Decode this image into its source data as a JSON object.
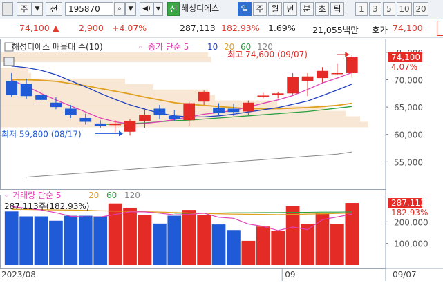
{
  "toolbar": {
    "checkbox_label": "",
    "market_label": "주",
    "mode_label": "전",
    "stock_code": "195870",
    "stock_name": "해성디에스",
    "new_badge": "신",
    "periods": [
      "일",
      "주",
      "월",
      "년",
      "분",
      "초",
      "틱"
    ],
    "active_period": "일",
    "intervals": [
      "1",
      "3",
      "5",
      "10",
      "20"
    ]
  },
  "quote": {
    "price": "74,100",
    "change_arrow": "▲",
    "change": "2,900",
    "change_pct": "+4.07%",
    "volume": "287,113",
    "volume_ratio": "182.93%",
    "turnover": "1.69%",
    "amount": "21,055백만",
    "ask_label": "호가",
    "ask_price": "74,100"
  },
  "price_panel": {
    "legend_name": "해성디에스 매물대 수(10)",
    "ma_label": "종가 단순 5",
    "ma_periods": [
      "10",
      "20",
      "60",
      "120"
    ],
    "high_label": "최고 74,600 (09/07)",
    "low_label": "최저 59,800 (08/17)",
    "current_price_tag": "74,100",
    "change_pct_tag": "4.07%",
    "y_ticks": [
      "75,000",
      "70,000",
      "65,000",
      "60,000",
      "55,000"
    ]
  },
  "volume_panel": {
    "legend_label": "거래량 단순 5",
    "ma_periods": [
      "20",
      "60",
      "120"
    ],
    "value_label": "287,113주(182.93%)",
    "volume_tag": "287,113",
    "ratio_tag": "182.93%",
    "y_ticks": [
      "200,000",
      "100,000"
    ]
  },
  "x_axis": {
    "labels": [
      "2023/08",
      "09"
    ],
    "cursor_date": "09/07"
  },
  "colors": {
    "up": "#e52b25",
    "down": "#1f5bd6",
    "ma5": "#e040b5",
    "ma10": "#2040c0",
    "ma20": "#e0a020",
    "ma60": "#2aa040",
    "ma120": "#888888"
  },
  "chart_data": {
    "type": "candlestick",
    "price": {
      "ylim": [
        50000,
        77000
      ],
      "candles": [
        {
          "o": 69800,
          "h": 71200,
          "l": 66800,
          "c": 67200
        },
        {
          "o": 69300,
          "h": 70200,
          "l": 66500,
          "c": 67000
        },
        {
          "o": 67200,
          "h": 68000,
          "l": 66000,
          "c": 66300
        },
        {
          "o": 65800,
          "h": 66800,
          "l": 64600,
          "c": 65000
        },
        {
          "o": 64700,
          "h": 65400,
          "l": 63000,
          "c": 63500
        },
        {
          "o": 63000,
          "h": 63800,
          "l": 61800,
          "c": 62300
        },
        {
          "o": 62000,
          "h": 62600,
          "l": 61200,
          "c": 61600
        },
        {
          "o": 61700,
          "h": 62600,
          "l": 60400,
          "c": 62000
        },
        {
          "o": 60500,
          "h": 62800,
          "l": 59800,
          "c": 62400
        },
        {
          "o": 62400,
          "h": 64800,
          "l": 61200,
          "c": 63600
        },
        {
          "o": 64700,
          "h": 65400,
          "l": 62800,
          "c": 63600
        },
        {
          "o": 63400,
          "h": 64400,
          "l": 62400,
          "c": 62800
        },
        {
          "o": 62600,
          "h": 66000,
          "l": 61600,
          "c": 65700
        },
        {
          "o": 66000,
          "h": 68000,
          "l": 65400,
          "c": 67800
        },
        {
          "o": 64900,
          "h": 65700,
          "l": 63600,
          "c": 63900
        },
        {
          "o": 64700,
          "h": 65600,
          "l": 63400,
          "c": 64100
        },
        {
          "o": 64200,
          "h": 66200,
          "l": 63600,
          "c": 65800
        },
        {
          "o": 67000,
          "h": 67600,
          "l": 66600,
          "c": 67100
        },
        {
          "o": 67200,
          "h": 67800,
          "l": 66600,
          "c": 67500
        },
        {
          "o": 67500,
          "h": 71200,
          "l": 67300,
          "c": 70500
        },
        {
          "o": 69800,
          "h": 71200,
          "l": 67000,
          "c": 70600
        },
        {
          "o": 70300,
          "h": 72300,
          "l": 69500,
          "c": 71600
        },
        {
          "o": 71200,
          "h": 73000,
          "l": 70800,
          "c": 71200
        },
        {
          "o": 71200,
          "h": 74600,
          "l": 70400,
          "c": 74100
        }
      ],
      "ma5": [
        69900,
        68800,
        67500,
        66300,
        65200,
        64100,
        63000,
        62300,
        61900,
        62000,
        62300,
        62700,
        63200,
        63700,
        64000,
        64400,
        65000,
        65700,
        66300,
        67100,
        68200,
        69400,
        70300,
        71300
      ],
      "ma10": [
        72500,
        72200,
        71700,
        70900,
        69800,
        68700,
        67500,
        66400,
        65400,
        64600,
        63900,
        63400,
        63200,
        63200,
        63400,
        63700,
        64100,
        64500,
        64900,
        65500,
        66100,
        67100,
        68100,
        69200
      ],
      "ma20": [
        70000,
        70000,
        69900,
        69700,
        69300,
        68900,
        68400,
        67900,
        67400,
        66800,
        66300,
        65800,
        65500,
        65300,
        65100,
        64900,
        64700,
        64700,
        64700,
        64800,
        64900,
        65100,
        65300,
        65700
      ],
      "ma60": [
        null,
        null,
        null,
        null,
        null,
        null,
        61800,
        61900,
        62000,
        62100,
        62300,
        62500,
        62600,
        62800,
        63000,
        63200,
        63400,
        63600,
        63800,
        64000,
        64200,
        64500,
        64800,
        65100
      ],
      "ma120": [
        null,
        52200,
        52400,
        52600,
        52800,
        53000,
        53200,
        53400,
        53600,
        53800,
        54000,
        54200,
        54400,
        54600,
        54800,
        55000,
        55200,
        55400,
        55600,
        55800,
        56000,
        56200,
        56400,
        56800
      ]
    },
    "volume": {
      "ylim": [
        0,
        300000
      ],
      "values": [
        248000,
        225000,
        225000,
        205000,
        228000,
        228000,
        225000,
        285000,
        265000,
        232000,
        192000,
        228000,
        255000,
        232000,
        188000,
        162000,
        112000,
        178000,
        158000,
        272000,
        190000,
        240000,
        190000,
        287113
      ],
      "ma5": [
        270000,
        262000,
        255000,
        242000,
        226000,
        222000,
        222000,
        234000,
        246000,
        246000,
        240000,
        232000,
        234000,
        240000,
        221000,
        216000,
        190000,
        179000,
        160000,
        176000,
        164000,
        210000,
        222000,
        236000
      ],
      "ma20": [
        258000,
        257000,
        256000,
        255000,
        254000,
        253000,
        251000,
        250000,
        249000,
        247000,
        245000,
        243000,
        241000,
        239000,
        237000,
        236000,
        235000,
        234000,
        233000,
        234000,
        236000,
        237000,
        239000,
        241000
      ],
      "ma60": [
        null,
        null,
        null,
        null,
        null,
        null,
        null,
        null,
        null,
        null,
        null,
        240000,
        240000,
        241000,
        241000,
        242000,
        242000,
        243000,
        243000,
        244000,
        244000,
        245000,
        245000,
        246000
      ]
    }
  }
}
